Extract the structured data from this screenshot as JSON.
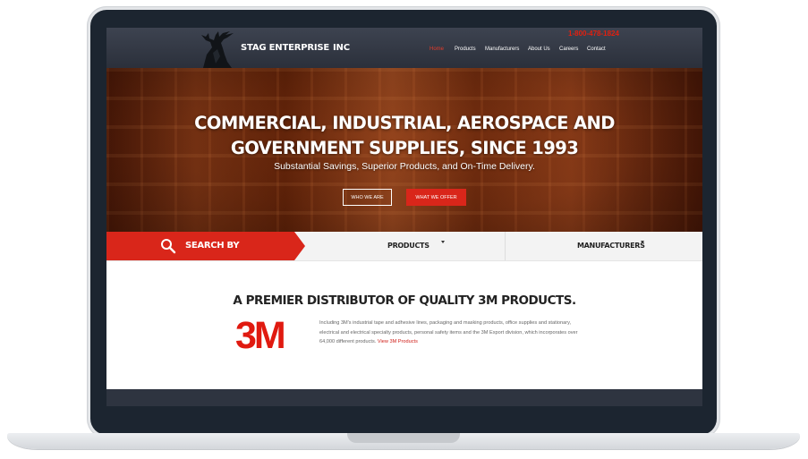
{
  "header": {
    "brand": "STAG ENTERPRISE",
    "brand_suffix": "INC",
    "phone": "1-800-478-1824",
    "nav": [
      {
        "label": "Home",
        "active": true
      },
      {
        "label": "Products",
        "active": false
      },
      {
        "label": "Manufacturers",
        "active": false
      },
      {
        "label": "About Us",
        "active": false
      },
      {
        "label": "Careers",
        "active": false
      },
      {
        "label": "Contact",
        "active": false
      }
    ]
  },
  "hero": {
    "title_line1": "COMMERCIAL, INDUSTRIAL, AEROSPACE AND",
    "title_line2": "GOVERNMENT SUPPLIES, SINCE 1993",
    "subtitle": "Substantial Savings, Superior Products, and On-Time Delivery.",
    "btn_who": "WHO WE ARE",
    "btn_what": "WHAT WE OFFER"
  },
  "search": {
    "label": "SEARCH BY",
    "dropdowns": [
      "PRODUCTS",
      "MANUFACTURERS"
    ]
  },
  "content": {
    "heading": "A PREMIER DISTRIBUTOR OF QUALITY 3M PRODUCTS.",
    "logo_text": "3M",
    "description": "Including 3M's industrial tape and adhesive lines, packaging and masking products, office supplies and stationary, electrical and electrical specialty products, personal safety items and the 3M Export division, which incorporates over 64,000 different products.",
    "link": "View 3M Products"
  },
  "colors": {
    "accent_red": "#d9261a",
    "header_bg": "#2b303b",
    "frame": "#1c2530"
  },
  "icons": [
    "stag-logo-icon",
    "search-icon",
    "chevron-down-icon"
  ]
}
